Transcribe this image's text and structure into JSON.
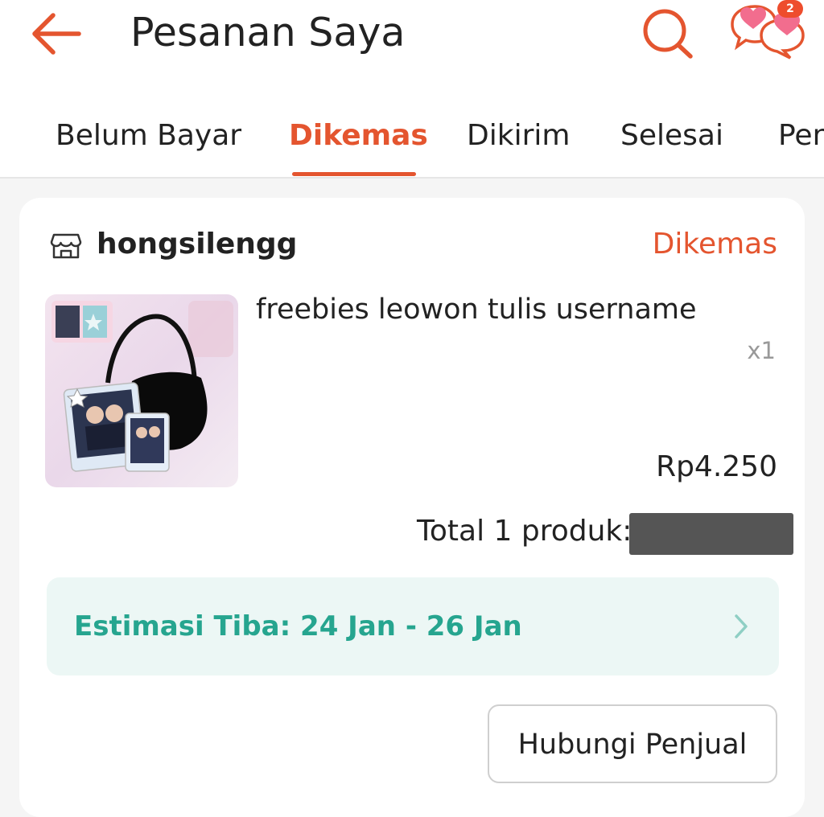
{
  "header": {
    "title": "Pesanan Saya",
    "back_icon": "arrow-left-icon",
    "search_icon": "search-icon",
    "chat_icon": "chat-icon",
    "chat_badge": "2",
    "accent_color": "#e4552f"
  },
  "tabs": [
    {
      "label": "Belum Bayar",
      "active": false
    },
    {
      "label": "Dikemas",
      "active": true
    },
    {
      "label": "Dikirim",
      "active": false
    },
    {
      "label": "Selesai",
      "active": false
    },
    {
      "label": "Pengembalian",
      "active": false
    }
  ],
  "order": {
    "shop_icon": "store-icon",
    "shop_name": "hongsilengg",
    "status": "Dikemas",
    "product": {
      "name": "freebies leowon tulis username",
      "quantity": "x1",
      "price": "Rp4.250"
    },
    "total_label": "Total 1 produk:",
    "total_value_hidden": true,
    "eta": "Estimasi Tiba: 24 Jan - 26 Jan",
    "eta_color": "#26a58f",
    "contact_button": "Hubungi Penjual"
  }
}
